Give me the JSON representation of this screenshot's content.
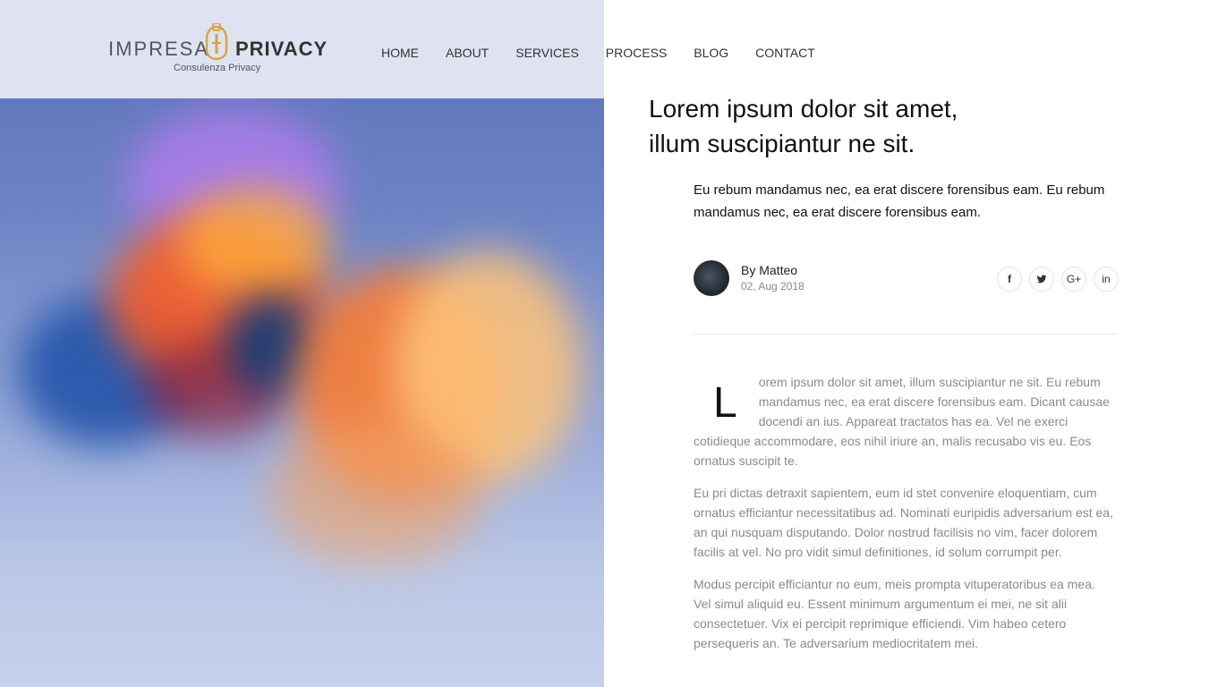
{
  "brand": {
    "word1": "IMPRESA",
    "word2": "PRIVACY",
    "tagline": "Consulenza Privacy",
    "accent_color": "#d4a545"
  },
  "nav": {
    "items": [
      {
        "label": "HOME"
      },
      {
        "label": "ABOUT"
      },
      {
        "label": "SERVICES"
      },
      {
        "label": "PROCESS"
      },
      {
        "label": "BLOG"
      },
      {
        "label": "CONTACT"
      }
    ]
  },
  "article": {
    "title_line1": "Lorem ipsum dolor sit amet,",
    "title_line2": "illum suscipiantur ne sit.",
    "lead": "Eu rebum mandamus nec, ea erat discere forensibus eam. Eu rebum mandamus nec, ea erat discere forensibus eam.",
    "author": {
      "name": "By Matteo",
      "date": "02, Aug 2018"
    },
    "social": [
      {
        "icon": "facebook-icon",
        "glyph": "f"
      },
      {
        "icon": "twitter-icon",
        "glyph": "🐦"
      },
      {
        "icon": "google-plus-icon",
        "glyph": "G+"
      },
      {
        "icon": "linkedin-icon",
        "glyph": "in"
      }
    ],
    "dropcap": "L",
    "paragraph1": "orem ipsum dolor sit amet, illum suscipiantur ne sit. Eu rebum mandamus nec, ea erat discere forensibus eam. Dicant causae docendi an ius. Appareat tractatos has ea. Vel ne exerci cotidieque accommodare, eos nihil iriure an, malis recusabo vis eu. Eos ornatus suscipit te.",
    "paragraph2": "Eu pri dictas detraxit sapientem, eum id stet convenire eloquentiam, cum ornatus efficiantur necessitatibus ad. Nominati euripidis adversarium est ea, an qui nusquam disputando. Dolor nostrud facilisis no vim, facer dolorem facilis at vel. No pro vidit simul definitiones, id solum corrumpit per.",
    "paragraph3": "Modus percipit efficiantur no eum, meis prompta vituperatoribus ea mea. Vel simul aliquid eu. Essent minimum argumentum ei mei, ne sit alii consectetuer. Vix ei percipit reprimique efficiendi. Vim habeo cetero persequeris an. Te adversarium mediocritatem mei."
  }
}
